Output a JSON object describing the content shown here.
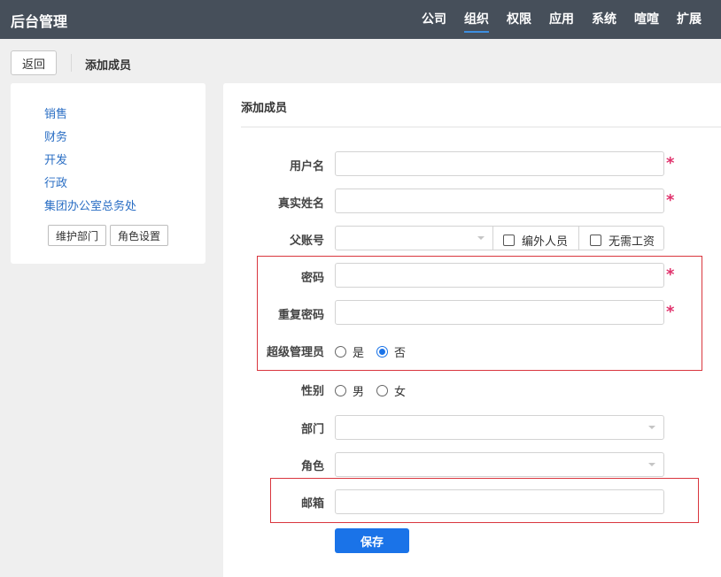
{
  "header": {
    "brand": "后台管理",
    "nav": [
      {
        "label": "公司",
        "active": false
      },
      {
        "label": "组织",
        "active": true
      },
      {
        "label": "权限",
        "active": false
      },
      {
        "label": "应用",
        "active": false
      },
      {
        "label": "系统",
        "active": false
      },
      {
        "label": "喧喧",
        "active": false
      },
      {
        "label": "扩展",
        "active": false
      }
    ]
  },
  "toolbar": {
    "back_label": "返回",
    "title": "添加成员"
  },
  "sidebar": {
    "departments": [
      "销售",
      "财务",
      "开发",
      "行政",
      "集团办公室总务处"
    ],
    "maintain_dept_label": "维护部门",
    "role_settings_label": "角色设置"
  },
  "form": {
    "title": "添加成员",
    "username_label": "用户名",
    "username_value": "",
    "realname_label": "真实姓名",
    "realname_value": "",
    "parent_label": "父账号",
    "external_label": "编外人员",
    "no_salary_label": "无需工资",
    "password_label": "密码",
    "password_value": "",
    "repeat_password_label": "重复密码",
    "repeat_password_value": "",
    "superadmin_label": "超级管理员",
    "superadmin_options": [
      "是",
      "否"
    ],
    "superadmin_selected": "否",
    "gender_label": "性别",
    "gender_options": [
      "男",
      "女"
    ],
    "dept_label": "部门",
    "role_label": "角色",
    "email_label": "邮箱",
    "email_value": "",
    "required_mark": "*",
    "save_label": "保存"
  },
  "colors": {
    "topbar": "#464f5a",
    "accent": "#1a73e8",
    "link": "#2a6ec4",
    "required": "#e0326c",
    "highlight": "#d9363e"
  }
}
